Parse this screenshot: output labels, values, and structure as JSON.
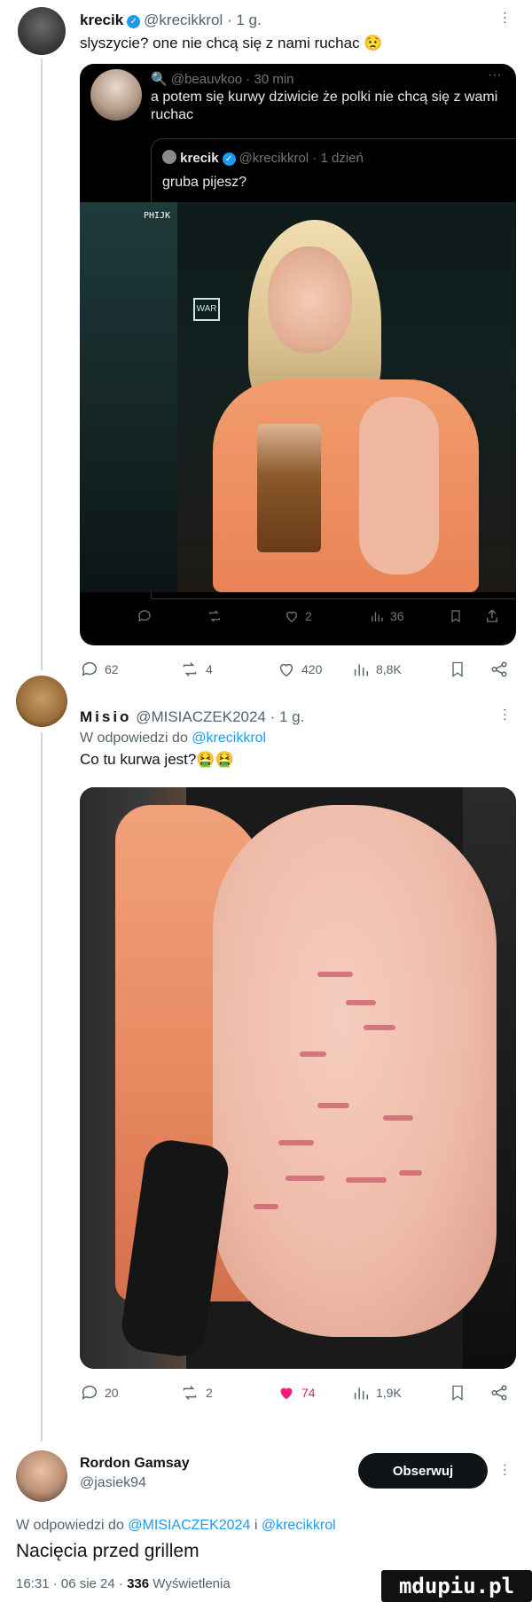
{
  "tweet1": {
    "name": "krecik",
    "handle": "@krecikkrol",
    "time": "1 g.",
    "text": "slyszycie? one nie chcą się z nami ruchac 😟",
    "quote": {
      "handle": "@beauvkoo",
      "time": "30 min",
      "text": "a potem się kurwy dziwicie że polki nie chcą się z wami ruchac",
      "inner": {
        "name": "krecik",
        "handle": "@krecikkrol",
        "time": "1 dzień",
        "text": "gruba pijesz?"
      },
      "photo_sign": "WAR",
      "photo_neon": "PHIJK",
      "actions": {
        "replies": "",
        "reposts": "",
        "likes": "2",
        "views": "36"
      }
    },
    "actions": {
      "replies": "62",
      "reposts": "4",
      "likes": "420",
      "views": "8,8K"
    }
  },
  "tweet2": {
    "name": "Misio",
    "handle": "@MISIACZEK2024",
    "time": "1 g.",
    "reply_prefix": "W odpowiedzi do",
    "reply_to": "@krecikkrol",
    "text": "Co tu kurwa jest?🤮🤮",
    "actions": {
      "replies": "20",
      "reposts": "2",
      "likes": "74",
      "views": "1,9K"
    }
  },
  "tweet3": {
    "name": "Rordon Gamsay",
    "handle": "@jasiek94",
    "follow_label": "Obserwuj",
    "reply_prefix": "W odpowiedzi do",
    "reply_to_1": "@MISIACZEK2024",
    "reply_and": "i",
    "reply_to_2": "@krecikkrol",
    "text": "Nacięcia przed grillem",
    "meta_time": "16:31 · 06 sie 24 ·",
    "meta_views": "336",
    "meta_views_label": "Wyświetlenia"
  },
  "watermark": "mdupiu.pl",
  "colors": {
    "accent": "#1d9bf0",
    "like_active": "#f91880",
    "text": "#0f1419",
    "muted": "#536471"
  }
}
